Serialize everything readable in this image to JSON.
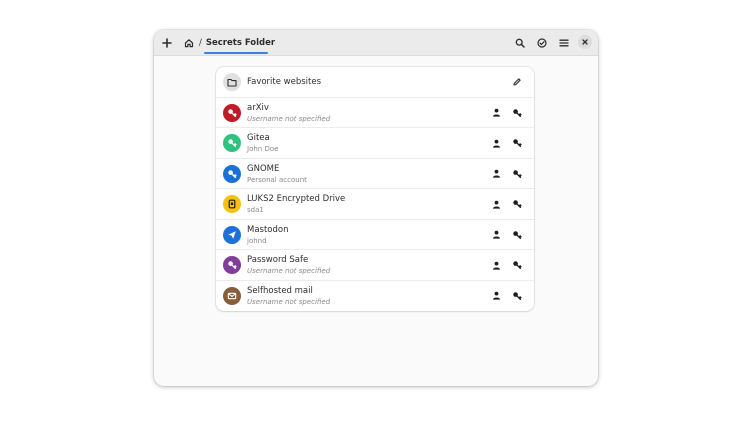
{
  "breadcrumb": {
    "separator": "/",
    "title": "Secrets Folder"
  },
  "folder": {
    "title": "Favorite websites"
  },
  "entries": [
    {
      "title": "arXiv",
      "subtitle": "Username not specified",
      "subtitle_italic": true,
      "icon": "key-icon",
      "color": "#c01c28"
    },
    {
      "title": "Gitea",
      "subtitle": "John Doe",
      "subtitle_italic": false,
      "icon": "key-icon",
      "color": "#2ec27e"
    },
    {
      "title": "GNOME",
      "subtitle": "Personal account",
      "subtitle_italic": false,
      "icon": "key-icon",
      "color": "#1c71d8"
    },
    {
      "title": "LUKS2 Encrypted Drive",
      "subtitle": "sda1",
      "subtitle_italic": false,
      "icon": "drive-icon",
      "color": "#f5c211"
    },
    {
      "title": "Mastodon",
      "subtitle": "johnd",
      "subtitle_italic": false,
      "icon": "send-icon",
      "color": "#1c71d8"
    },
    {
      "title": "Password Safe",
      "subtitle": "Username not specified",
      "subtitle_italic": true,
      "icon": "key-icon",
      "color": "#813d9c"
    },
    {
      "title": "Selfhosted mail",
      "subtitle": "Username not specified",
      "subtitle_italic": true,
      "icon": "mail-icon",
      "color": "#865e3c"
    }
  ],
  "colors": {
    "accent": "#3584e4",
    "headerbar": "#ebebeb",
    "window": "#fafafa"
  }
}
